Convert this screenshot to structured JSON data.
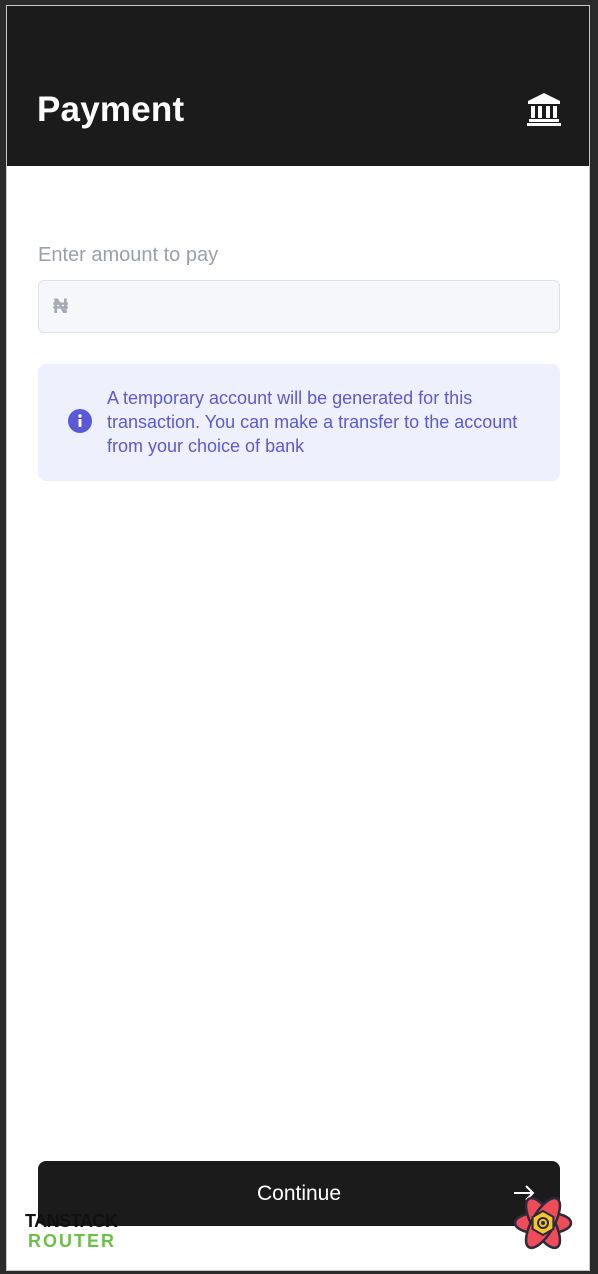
{
  "header": {
    "title": "Payment",
    "icon": "bank-icon"
  },
  "amount": {
    "label": "Enter amount to pay",
    "currency_symbol": "₦",
    "value": "",
    "placeholder": ""
  },
  "info": {
    "icon": "info-icon",
    "message": "A temporary account will be generated for this transaction. You can make a transfer to the account from your choice of bank"
  },
  "actions": {
    "continue_label": "Continue",
    "continue_icon": "arrow-right-icon"
  },
  "devtools": {
    "tanstack_line1": "TANSTACK",
    "tanstack_line2": "ROUTER",
    "react_icon": "react-query-logo-icon"
  },
  "colors": {
    "header_bg": "#1b1b1b",
    "info_bg": "#eef0fd",
    "info_text": "#5a5ad8",
    "button_bg": "#1b1b1b",
    "router_green": "#6cc04a"
  }
}
